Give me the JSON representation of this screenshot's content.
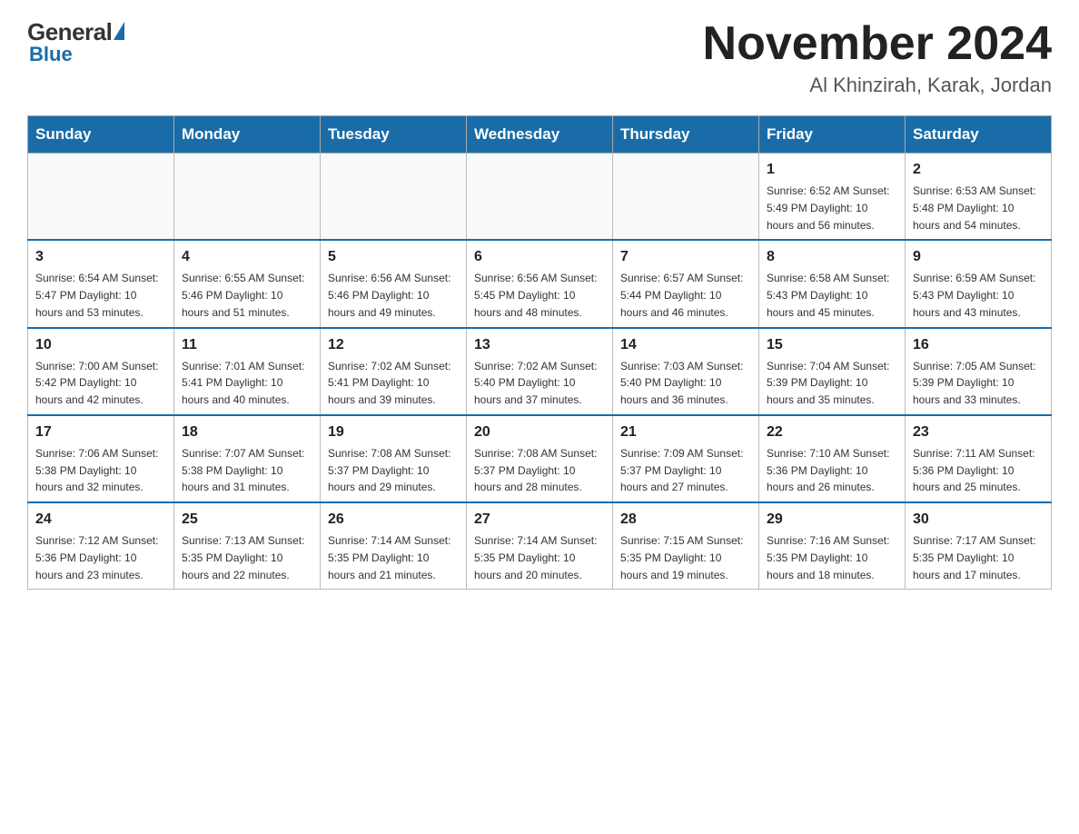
{
  "header": {
    "logo_general": "General",
    "logo_blue": "Blue",
    "title": "November 2024",
    "subtitle": "Al Khinzirah, Karak, Jordan"
  },
  "days_of_week": [
    "Sunday",
    "Monday",
    "Tuesday",
    "Wednesday",
    "Thursday",
    "Friday",
    "Saturday"
  ],
  "weeks": [
    [
      {
        "day": "",
        "info": ""
      },
      {
        "day": "",
        "info": ""
      },
      {
        "day": "",
        "info": ""
      },
      {
        "day": "",
        "info": ""
      },
      {
        "day": "",
        "info": ""
      },
      {
        "day": "1",
        "info": "Sunrise: 6:52 AM\nSunset: 5:49 PM\nDaylight: 10 hours and 56 minutes."
      },
      {
        "day": "2",
        "info": "Sunrise: 6:53 AM\nSunset: 5:48 PM\nDaylight: 10 hours and 54 minutes."
      }
    ],
    [
      {
        "day": "3",
        "info": "Sunrise: 6:54 AM\nSunset: 5:47 PM\nDaylight: 10 hours and 53 minutes."
      },
      {
        "day": "4",
        "info": "Sunrise: 6:55 AM\nSunset: 5:46 PM\nDaylight: 10 hours and 51 minutes."
      },
      {
        "day": "5",
        "info": "Sunrise: 6:56 AM\nSunset: 5:46 PM\nDaylight: 10 hours and 49 minutes."
      },
      {
        "day": "6",
        "info": "Sunrise: 6:56 AM\nSunset: 5:45 PM\nDaylight: 10 hours and 48 minutes."
      },
      {
        "day": "7",
        "info": "Sunrise: 6:57 AM\nSunset: 5:44 PM\nDaylight: 10 hours and 46 minutes."
      },
      {
        "day": "8",
        "info": "Sunrise: 6:58 AM\nSunset: 5:43 PM\nDaylight: 10 hours and 45 minutes."
      },
      {
        "day": "9",
        "info": "Sunrise: 6:59 AM\nSunset: 5:43 PM\nDaylight: 10 hours and 43 minutes."
      }
    ],
    [
      {
        "day": "10",
        "info": "Sunrise: 7:00 AM\nSunset: 5:42 PM\nDaylight: 10 hours and 42 minutes."
      },
      {
        "day": "11",
        "info": "Sunrise: 7:01 AM\nSunset: 5:41 PM\nDaylight: 10 hours and 40 minutes."
      },
      {
        "day": "12",
        "info": "Sunrise: 7:02 AM\nSunset: 5:41 PM\nDaylight: 10 hours and 39 minutes."
      },
      {
        "day": "13",
        "info": "Sunrise: 7:02 AM\nSunset: 5:40 PM\nDaylight: 10 hours and 37 minutes."
      },
      {
        "day": "14",
        "info": "Sunrise: 7:03 AM\nSunset: 5:40 PM\nDaylight: 10 hours and 36 minutes."
      },
      {
        "day": "15",
        "info": "Sunrise: 7:04 AM\nSunset: 5:39 PM\nDaylight: 10 hours and 35 minutes."
      },
      {
        "day": "16",
        "info": "Sunrise: 7:05 AM\nSunset: 5:39 PM\nDaylight: 10 hours and 33 minutes."
      }
    ],
    [
      {
        "day": "17",
        "info": "Sunrise: 7:06 AM\nSunset: 5:38 PM\nDaylight: 10 hours and 32 minutes."
      },
      {
        "day": "18",
        "info": "Sunrise: 7:07 AM\nSunset: 5:38 PM\nDaylight: 10 hours and 31 minutes."
      },
      {
        "day": "19",
        "info": "Sunrise: 7:08 AM\nSunset: 5:37 PM\nDaylight: 10 hours and 29 minutes."
      },
      {
        "day": "20",
        "info": "Sunrise: 7:08 AM\nSunset: 5:37 PM\nDaylight: 10 hours and 28 minutes."
      },
      {
        "day": "21",
        "info": "Sunrise: 7:09 AM\nSunset: 5:37 PM\nDaylight: 10 hours and 27 minutes."
      },
      {
        "day": "22",
        "info": "Sunrise: 7:10 AM\nSunset: 5:36 PM\nDaylight: 10 hours and 26 minutes."
      },
      {
        "day": "23",
        "info": "Sunrise: 7:11 AM\nSunset: 5:36 PM\nDaylight: 10 hours and 25 minutes."
      }
    ],
    [
      {
        "day": "24",
        "info": "Sunrise: 7:12 AM\nSunset: 5:36 PM\nDaylight: 10 hours and 23 minutes."
      },
      {
        "day": "25",
        "info": "Sunrise: 7:13 AM\nSunset: 5:35 PM\nDaylight: 10 hours and 22 minutes."
      },
      {
        "day": "26",
        "info": "Sunrise: 7:14 AM\nSunset: 5:35 PM\nDaylight: 10 hours and 21 minutes."
      },
      {
        "day": "27",
        "info": "Sunrise: 7:14 AM\nSunset: 5:35 PM\nDaylight: 10 hours and 20 minutes."
      },
      {
        "day": "28",
        "info": "Sunrise: 7:15 AM\nSunset: 5:35 PM\nDaylight: 10 hours and 19 minutes."
      },
      {
        "day": "29",
        "info": "Sunrise: 7:16 AM\nSunset: 5:35 PM\nDaylight: 10 hours and 18 minutes."
      },
      {
        "day": "30",
        "info": "Sunrise: 7:17 AM\nSunset: 5:35 PM\nDaylight: 10 hours and 17 minutes."
      }
    ]
  ]
}
